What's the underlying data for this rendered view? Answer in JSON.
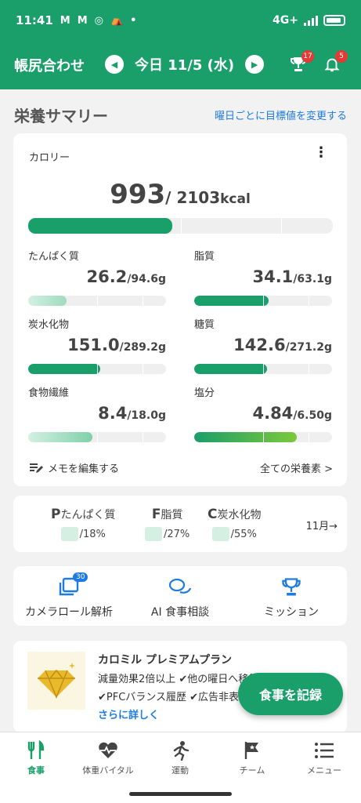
{
  "status_bar": {
    "time": "11:41",
    "notif_icons": [
      "M",
      "M",
      "◎",
      "⛺",
      "•"
    ],
    "network": "4G+"
  },
  "header": {
    "title": "帳尻合わせ",
    "date": "今日 11/5 (水)",
    "trophy_badge": "17",
    "bell_badge": "5"
  },
  "summary": {
    "title": "栄養サマリー",
    "link": "曜日ごとに目標値を変更する",
    "calorie": {
      "label": "カロリー",
      "value": "993",
      "target": "/ 2103",
      "unit": "kcal",
      "progress": 0.472
    },
    "nutrients": [
      {
        "name": "たんぱく質",
        "value": "26.2",
        "target": "/94.6g",
        "progress": 0.277
      },
      {
        "name": "脂質",
        "value": "34.1",
        "target": "/63.1g",
        "progress": 0.54
      },
      {
        "name": "炭水化物",
        "value": "151.0",
        "target": "/289.2g",
        "progress": 0.522
      },
      {
        "name": "糖質",
        "value": "142.6",
        "target": "/271.2g",
        "progress": 0.526
      },
      {
        "name": "食物繊維",
        "value": "8.4",
        "target": "/18.0g",
        "progress": 0.467
      },
      {
        "name": "塩分",
        "value": "4.84",
        "target": "/6.50g",
        "progress": 0.745
      }
    ],
    "memo_label": "メモを編集する",
    "all_nutrients_label": "全ての栄養素 >"
  },
  "pfc": {
    "items": [
      {
        "letter": "P",
        "name": "たんぱく質",
        "value": "/18%"
      },
      {
        "letter": "F",
        "name": "脂質",
        "value": "/27%"
      },
      {
        "letter": "C",
        "name": "炭水化物",
        "value": "/55%"
      }
    ],
    "month_link": "11月→"
  },
  "actions": {
    "camera_roll": "カメラロール解析",
    "camera_badge": "30",
    "ai_consult": "AI 食事相談",
    "mission": "ミッション"
  },
  "premium": {
    "title": "カロミル プレミアムプラン",
    "line1": "減量効果2倍以上 ✔他の曜日へ移行可",
    "line2": "✔PFCバランス履歴 ✔広告非表示",
    "more": "さらに詳しく"
  },
  "fab_label": "食事を記録",
  "bottom_nav": {
    "meal": "食事",
    "weight_vital": "体重バイタル",
    "exercise": "運動",
    "team": "チーム",
    "menu": "メニュー"
  },
  "colors": {
    "brand_green": "#1a9e6a",
    "link_blue": "#1e7be0",
    "badge_red": "#e53935"
  }
}
